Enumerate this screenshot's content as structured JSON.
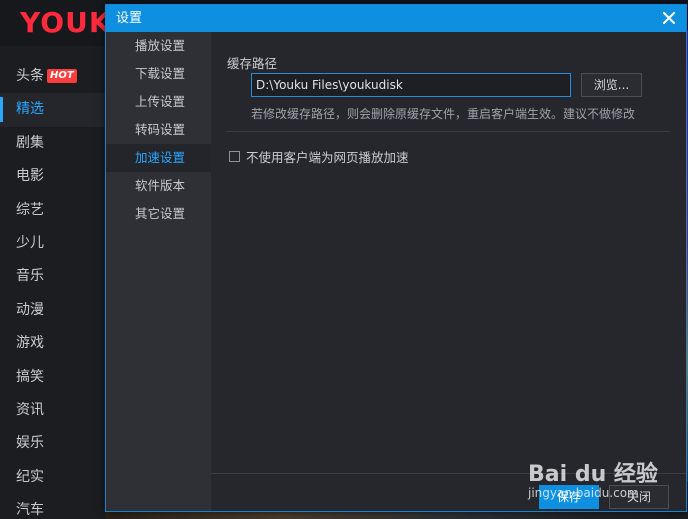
{
  "app": {
    "logo_text": "YOUK",
    "nav": [
      {
        "label": "头条",
        "badge": "HOT"
      },
      {
        "label": "精选"
      },
      {
        "label": "剧集"
      },
      {
        "label": "电影"
      },
      {
        "label": "综艺"
      },
      {
        "label": "少儿"
      },
      {
        "label": "音乐"
      },
      {
        "label": "动漫"
      },
      {
        "label": "游戏"
      },
      {
        "label": "搞笑"
      },
      {
        "label": "资讯"
      },
      {
        "label": "娱乐"
      },
      {
        "label": "纪实"
      },
      {
        "label": "汽车"
      }
    ],
    "accent_color": "#2aa7ff",
    "brand_color": "#ff2a3c"
  },
  "dialog": {
    "title": "设置",
    "menu": [
      {
        "label": "播放设置"
      },
      {
        "label": "下载设置"
      },
      {
        "label": "上传设置"
      },
      {
        "label": "转码设置"
      },
      {
        "label": "加速设置",
        "active": true
      },
      {
        "label": "软件版本"
      },
      {
        "label": "其它设置"
      }
    ],
    "cache": {
      "section_title": "缓存路径",
      "path_value": "D:\\Youku Files\\youkudisk",
      "browse_label": "浏览...",
      "hint": "若修改缓存路径，则会删除原缓存文件，重启客户端生效。建议不做修改"
    },
    "option": {
      "label": "不使用客户端为网页播放加速",
      "checked": false
    },
    "buttons": {
      "ok_label": "保存",
      "close_label": "关闭"
    },
    "titlebar_color": "#0e8fe0"
  },
  "watermark": {
    "logo": "Bai du 经验",
    "url": "jingyan.baidu.com"
  }
}
